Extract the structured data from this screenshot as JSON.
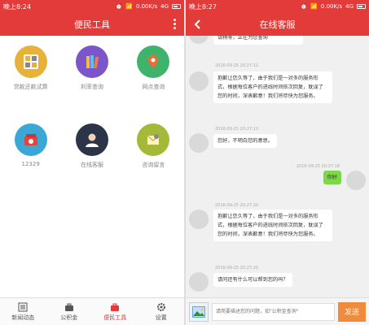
{
  "left": {
    "status": {
      "time": "晚上8:24",
      "signal": "4G",
      "speed": "0.00K/s"
    },
    "title": "便民工具",
    "tools": [
      {
        "label": "贷款还款试算",
        "icon": "calculator-icon",
        "color": "#e8b23a"
      },
      {
        "label": "利率查询",
        "icon": "books-icon",
        "color": "#7b55c9"
      },
      {
        "label": "网点查询",
        "icon": "map-pin-icon",
        "color": "#3fb36b"
      },
      {
        "label": "12329",
        "icon": "telephone-icon",
        "color": "#3aa7d6"
      },
      {
        "label": "在线客服",
        "icon": "customer-service-icon",
        "color": "#2c3547"
      },
      {
        "label": "咨询留言",
        "icon": "message-envelope-icon",
        "color": "#a5b938"
      }
    ],
    "tabs": [
      {
        "label": "新闻动态",
        "icon": "news-icon"
      },
      {
        "label": "公积金",
        "icon": "briefcase-icon"
      },
      {
        "label": "便民工具",
        "icon": "toolbox-icon"
      },
      {
        "label": "设置",
        "icon": "gear-icon"
      }
    ]
  },
  "right": {
    "status": {
      "time": "晚上8:27",
      "signal": "4G",
      "speed": "0.00K/s"
    },
    "title": "在线客服",
    "messages": [
      {
        "from": "agent",
        "time": "",
        "text": "请稍等，正在为您查询"
      },
      {
        "from": "agent",
        "time": "2016-09-25 20:27:12",
        "text": "抱歉让您久等了，由于我们是一对多的服务形式，根据每位客户的进线时间依次回复，耽误了您的时间，深表歉意！我们将尽快为您服务。"
      },
      {
        "from": "agent",
        "time": "2016-09-25 20:27:13",
        "text": "您好，不明白您的意思。"
      },
      {
        "from": "user",
        "time": "2016-09-25 20:27:18",
        "text": "你好"
      },
      {
        "from": "agent",
        "time": "2016-09-25 20:27:20",
        "text": "抱歉让您久等了，由于我们是一对多的服务形式，根据每位客户的进线时间依次回复，耽误了您的时间，深表歉意！我们将尽快为您服务。"
      },
      {
        "from": "agent",
        "time": "2016-09-25 20:27:20",
        "text": "请问还有什么可以帮到您的吗？"
      }
    ],
    "input_placeholder": "请简要描述您的问题，如\"公积金查询\"",
    "send_label": "发送"
  },
  "colors": {
    "brand": "#e33a3a",
    "send": "#f08a3c",
    "user_bubble": "#7cd848"
  }
}
